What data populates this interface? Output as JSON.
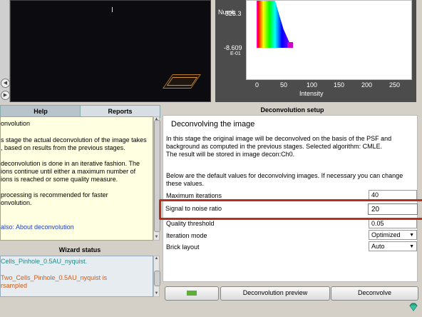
{
  "histogram": {
    "y_label": "Numb",
    "y_ticks": [
      "325.3",
      "-8.609"
    ],
    "y_exponent": "E-01",
    "x_ticks": [
      "0",
      "50",
      "100",
      "150",
      "200",
      "250"
    ],
    "x_label": "Intensity"
  },
  "tabs": {
    "help": "Help",
    "reports": "Reports"
  },
  "help": {
    "title": "onvolution",
    "p1": "s stage the actual deconvolution of the image takes",
    "p1b": ", based on results from the previous stages.",
    "p2": "deconvolution is done in an iterative fashion. The",
    "p2b": "ions continue until either a maximum number of",
    "p2c": "ions is reached or some quality measure.",
    "p3": "processing is recommended for faster",
    "p3b": "onvolution.",
    "link_prefix": "also: ",
    "link": "About deconvolution"
  },
  "wizard_status": {
    "title": "Wizard status",
    "line1": "Cells_Pinhole_0.5AU_nyquist.",
    "line2": "Two_Cells_Pinhole_0.5AU_nyquist is",
    "line3": "rsampled",
    "colors": {
      "ok": "#1f8a8a",
      "warn": "#d45a1a"
    }
  },
  "setup": {
    "header": "Deconvolution setup",
    "heading": "Deconvolving the image",
    "intro1": "In this stage the original image will be deconvolved on the basis of the PSF and",
    "intro2": "background as computed in the previous stages. Selected algorithm: CMLE.",
    "intro3": "The result will be stored in image decon:Ch0.",
    "defaults1": "Below are the default values for deconvolving images. If necessary you can change",
    "defaults2": "these values.",
    "max_iterations_label": "Maximum iterations",
    "max_iterations_value": "40",
    "snr_label": "Signal to noise ratio",
    "snr_value": "20",
    "quality_label": "Quality threshold",
    "quality_value": "0.05",
    "iteration_mode_label": "Iteration mode",
    "iteration_mode_value": "Optimized",
    "brick_layout_label": "Brick layout",
    "brick_layout_value": "Auto"
  },
  "buttons": {
    "preview": "Deconvolution preview",
    "deconvolve": "Deconvolve"
  },
  "icons": {
    "back": "back-arrow-icon",
    "gem": "gem-icon"
  }
}
